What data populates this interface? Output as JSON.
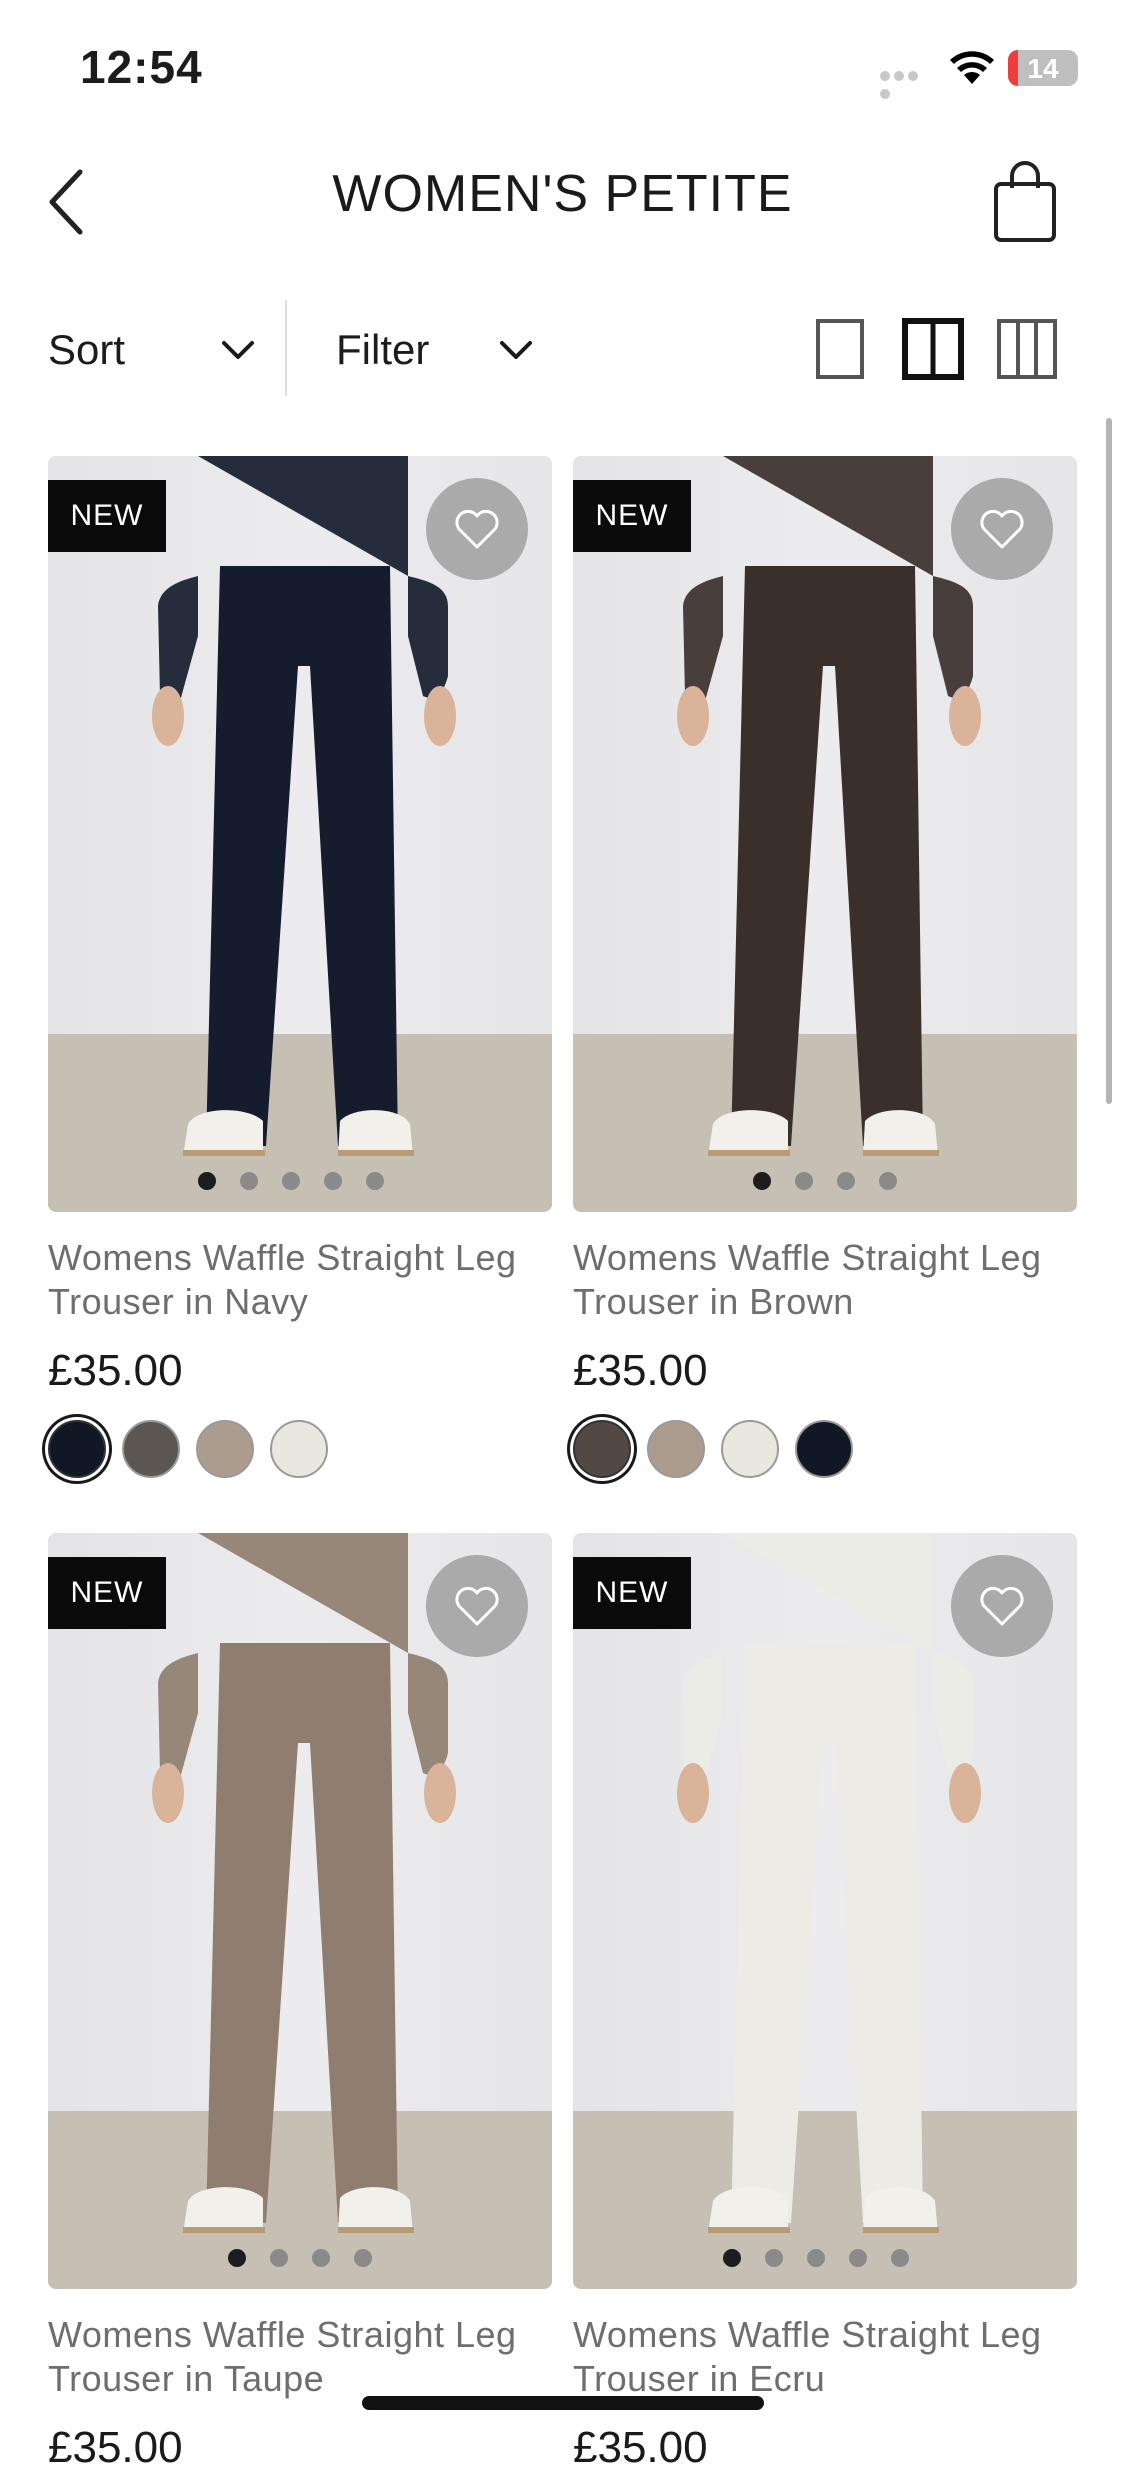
{
  "status_bar": {
    "time": "12:54",
    "battery": "14",
    "battery_level": 0.14
  },
  "header": {
    "title": "WOMEN'S PETITE"
  },
  "toolbar": {
    "sort_label": "Sort",
    "filter_label": "Filter"
  },
  "products": [
    {
      "badge": "NEW",
      "name": "Womens Waffle Straight Leg Trouser in Navy",
      "price": "£35.00",
      "garment_color": "#141c2d",
      "swatches": [
        "#101826",
        "#5c5652",
        "#ab9c8d",
        "#e9e8de"
      ],
      "selected_swatch": 0,
      "image_dots": 5,
      "active_dot": 0
    },
    {
      "badge": "NEW",
      "name": "Womens Waffle Straight Leg Trouser in Brown",
      "price": "£35.00",
      "garment_color": "#3a2f2b",
      "swatches": [
        "#524944",
        "#ab9c8d",
        "#e9e8de",
        "#101826"
      ],
      "selected_swatch": 0,
      "image_dots": 4,
      "active_dot": 0
    },
    {
      "badge": "NEW",
      "name": "Womens Waffle Straight Leg Trouser in Taupe",
      "price": "£35.00",
      "garment_color": "#8f7e6f",
      "swatches": [],
      "selected_swatch": 0,
      "image_dots": 4,
      "active_dot": 0
    },
    {
      "badge": "NEW",
      "name": "Womens Waffle Straight Leg Trouser in Ecru",
      "price": "£35.00",
      "garment_color": "#ecebe6",
      "swatches": [],
      "selected_swatch": 0,
      "image_dots": 5,
      "active_dot": 0
    }
  ]
}
